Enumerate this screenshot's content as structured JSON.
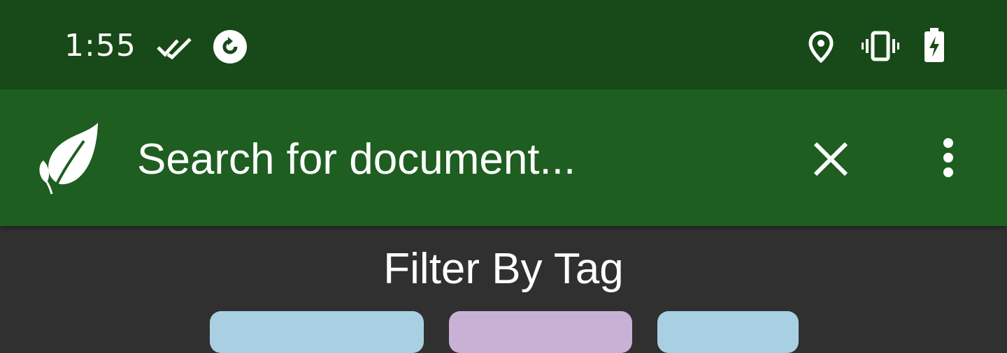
{
  "status_bar": {
    "time": "1:55",
    "icons": [
      "double-check-icon",
      "sync-icon",
      "location-icon",
      "vibrate-icon",
      "battery-charging-icon"
    ],
    "background_color": "#184918"
  },
  "toolbar": {
    "logo_icon": "leaf-icon",
    "search_placeholder": "Search for document...",
    "clear_icon": "close-icon",
    "menu_icon": "more-vertical-icon",
    "background_color": "#1e5e21"
  },
  "filter": {
    "title": "Filter By Tag",
    "tag_colors": [
      "#a9cfe2",
      "#c9b1d6",
      "#a9cfe2"
    ]
  }
}
